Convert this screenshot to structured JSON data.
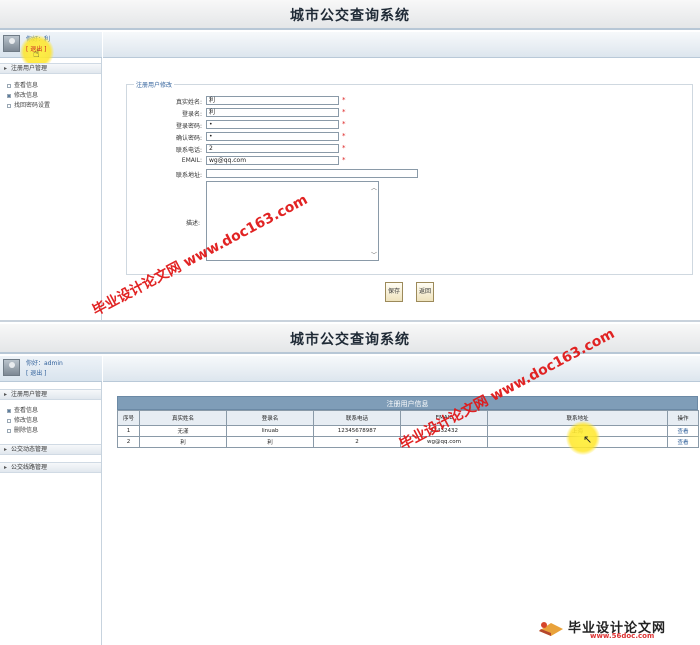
{
  "app": {
    "title": "城市公交查询系统"
  },
  "screen_edit": {
    "user": {
      "greeting": "你好：利",
      "logout": "退出"
    },
    "menu_section": "注册用户管理",
    "menu_items": [
      "查看信息",
      "修改信息",
      "找回密码设置"
    ],
    "form": {
      "legend": "注册用户修改",
      "fields": [
        {
          "label": "真实姓名:",
          "value": "利",
          "required": "*"
        },
        {
          "label": "登录名:",
          "value": "利",
          "required": "*"
        },
        {
          "label": "登录密码:",
          "value": "•",
          "required": "*"
        },
        {
          "label": "确认密码:",
          "value": "•",
          "required": "*"
        },
        {
          "label": "联系电话:",
          "value": "2",
          "required": "*"
        },
        {
          "label": "EMAIL:",
          "value": "wg@qq.com",
          "required": "*"
        },
        {
          "label": "联系地址:",
          "value": "",
          "required": ""
        }
      ],
      "desc_label": "描述:",
      "save_label": "保存",
      "back_label": "返回"
    },
    "watermark": "毕业设计论文网 www.doc163.com"
  },
  "screen_list": {
    "user": {
      "greeting": "你好：admin",
      "logout": "退出"
    },
    "menu_sections": [
      "注册用户管理",
      "公交动态管理",
      "公交线路管理"
    ],
    "menu_items": [
      "查看信息",
      "修改信息",
      "删除信息"
    ],
    "table": {
      "caption": "注册用户信息",
      "headers": [
        "序号",
        "真实姓名",
        "登录名",
        "联系电话",
        "EMAIL",
        "联系地址",
        "操作"
      ],
      "rows": [
        [
          "1",
          "无漾",
          "linuab",
          "12345678987",
          "23432432",
          "上海",
          "查看"
        ],
        [
          "2",
          "利",
          "利",
          "2",
          "wg@qq.com",
          "",
          "查看"
        ]
      ]
    },
    "watermark": "毕业设计论文网 www.doc163.com"
  },
  "footer_logo": {
    "text": "毕业设计论文网",
    "url": "www.56doc.com"
  }
}
